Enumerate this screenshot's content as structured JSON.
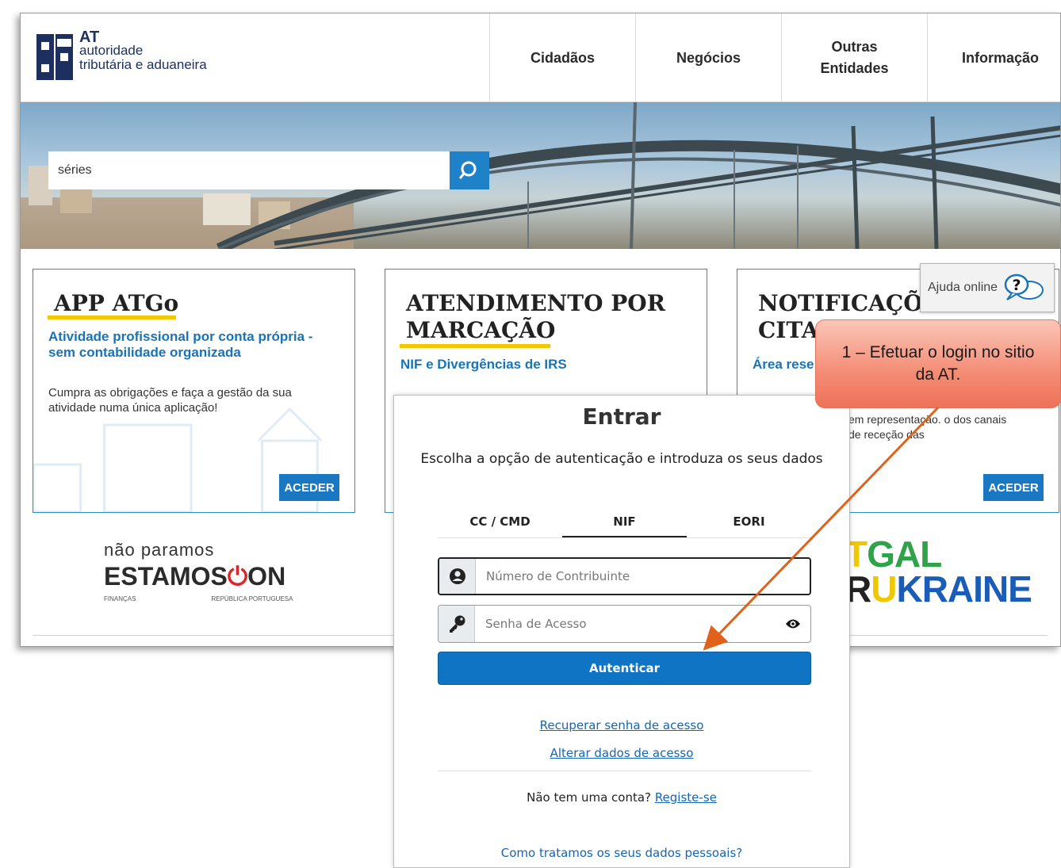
{
  "site": {
    "logo": {
      "abbr": "AT",
      "line1": "autoridade",
      "line2": "tributária e aduaneira"
    },
    "nav": [
      {
        "label": "Cidadãos"
      },
      {
        "label": "Negócios"
      },
      {
        "label": "Outras Entidades"
      },
      {
        "label": "Informação"
      }
    ],
    "search": {
      "value": "séries"
    },
    "cards": [
      {
        "title": "APP ATGo",
        "subtitle": "Atividade profissional por conta própria - sem contabilidade organizada",
        "description": "Cumpra as obrigações e faça a gestão da sua atividade numa única aplicação!",
        "button": "ACEDER"
      },
      {
        "title": "ATENDIMENTO POR MARCAÇÃO",
        "subtitle": "NIF e Divergências de IRS"
      },
      {
        "title": "NOTIFICAÇÕI CITAÇ",
        "subtitle": "Área rese",
        "description": "em representação. o dos canais de receção das",
        "button": "ACEDER"
      }
    ],
    "estamos": {
      "line1": "não paramos",
      "line2a": "ESTAMOS",
      "line2b": "ON",
      "foot1": "FINANÇAS",
      "foot2": "REPÚBLICA PORTUGUESA"
    },
    "ukraine": {
      "line1a": "T",
      "line1b": "GAL",
      "line2a": "R",
      "line2b": "KRAINE"
    }
  },
  "help": {
    "label": "Ajuda online"
  },
  "callout": {
    "text": "1 – Efetuar o login no sitio da AT."
  },
  "login": {
    "title": "Entrar",
    "description": "Escolha a opção de autenticação e introduza os seus dados",
    "tabs": [
      {
        "label": "CC / CMD",
        "active": false
      },
      {
        "label": "NIF",
        "active": true
      },
      {
        "label": "EORI",
        "active": false
      }
    ],
    "nif_placeholder": "Número de Contribuinte",
    "password_placeholder": "Senha de Acesso",
    "submit": "Autenticar",
    "recover_link": "Recuperar senha de acesso",
    "change_link": "Alterar dados de acesso",
    "signup_prompt": "Não tem uma conta?",
    "signup_link": "Registe-se",
    "privacy_link": "Como tratamos os seus dados pessoais?"
  },
  "colors": {
    "accent": "#1a78c2",
    "highlight": "#f2c800",
    "callout": "#f48c75",
    "arrow": "#e0621a"
  }
}
